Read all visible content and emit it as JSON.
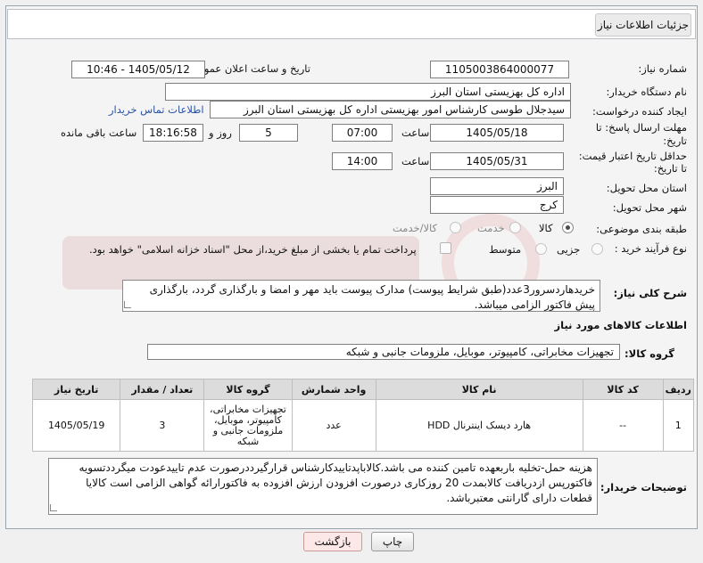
{
  "header": {
    "tab_label": "جزئیات اطلاعات نیاز"
  },
  "fields": {
    "need_number": {
      "label": "شماره نیاز:",
      "value": "1105003864000077"
    },
    "announce_datetime": {
      "label": "تاریخ و ساعت اعلان عمومی:",
      "value": "1405/05/12 - 10:46"
    },
    "buyer_org": {
      "label": "نام دستگاه خریدار:",
      "value": "اداره کل بهزیستی استان البرز"
    },
    "requester": {
      "label": "ایجاد کننده درخواست:",
      "value": "سیدجلال طوسی کارشناس امور بهزیستی اداره کل بهزیستی استان البرز",
      "contact_link": "اطلاعات تماس خریدار"
    },
    "reply_deadline": {
      "label_line1": "مهلت ارسال پاسخ: تا",
      "label_line2": "تاریخ:",
      "date": "1405/05/18",
      "time_label": "ساعت",
      "time": "07:00",
      "days": "5",
      "days_label": "روز و",
      "remaining_time": "18:16:58",
      "remaining_label": "ساعت باقی مانده"
    },
    "price_validity": {
      "label_line1": "حداقل تاریخ اعتبار قیمت:",
      "label_line2": "تا تاریخ:",
      "date": "1405/05/31",
      "time_label": "ساعت",
      "time": "14:00"
    },
    "delivery_province": {
      "label": "استان محل تحویل:",
      "value": "البرز"
    },
    "delivery_city": {
      "label": "شهر محل تحویل:",
      "value": "کرج"
    },
    "category": {
      "label": "طبقه بندی موضوعی:",
      "options": [
        "کالا",
        "خدمت",
        "کالا/خدمت"
      ],
      "selected": "کالا"
    },
    "process_type": {
      "label": "نوع فرآیند خرید :",
      "options": [
        "جزیی",
        "متوسط"
      ],
      "selected": "",
      "payment_note": "پرداخت تمام یا بخشی از مبلغ خرید،از محل \"اسناد خزانه اسلامی\" خواهد بود."
    }
  },
  "general_description": {
    "label": "شرح کلی نیاز:",
    "value": "خریدهاردسرور3عدد(طبق شرایط پیوست) مدارک پیوست باید مهر و امضا و بارگذاری گردد، بارگذاری پیش فاکتور الزامی میباشد."
  },
  "goods_info": {
    "section_title": "اطلاعات کالاهای مورد نیاز",
    "group_label": "گروه کالا:",
    "group_value": "تجهیزات مخابراتی، کامپیوتر، موبایل، ملزومات جانبی و شبکه"
  },
  "table": {
    "headers": [
      "ردیف",
      "کد کالا",
      "نام کالا",
      "واحد شمارش",
      "گروه کالا",
      "تعداد / مقدار",
      "تاریخ نیاز"
    ],
    "rows": [
      {
        "row": "1",
        "code": "--",
        "name": "هارد دیسک اینترنال HDD",
        "unit": "عدد",
        "group": "تجهیزات مخابراتی، کامپیوتر، موبایل، ملزومات جانبی و شبکه",
        "qty": "3",
        "date": "1405/05/19"
      }
    ]
  },
  "buyer_notes": {
    "label": "توضیحات خریدار:",
    "value": "هزینه حمل-تخلیه باربعهده تامین کننده می باشد.کالاباپدتاییدکارشناس قرارگیرددرصورت عدم تاییدعودت میگرددتسویه فاکتورپس ازدریافت کالابمدت 20 روزکاری درصورت افزودن ارزش افزوده به فاکتورارائه گواهی الزامی است کالایا قطعات دارای گارانتی معتبرباشد."
  },
  "buttons": {
    "print": "چاپ",
    "back": "بازگشت"
  },
  "colors": {
    "link": "#2a52a6",
    "table_header": "#dcdcdc",
    "back_button": "#fde8e8"
  }
}
